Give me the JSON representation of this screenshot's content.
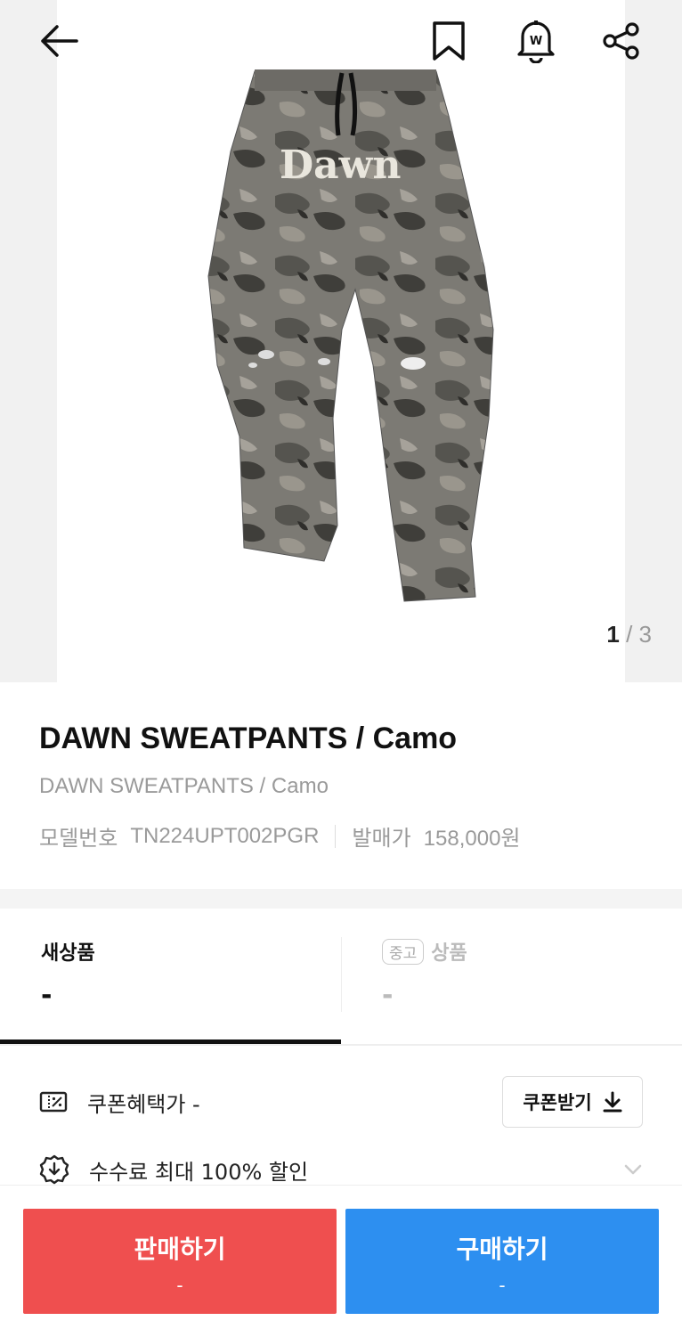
{
  "nav": {
    "back_icon": "arrow-left-icon",
    "bookmark_icon": "bookmark-icon",
    "alarm_icon": "bell-w-icon",
    "share_icon": "share-icon"
  },
  "gallery": {
    "image_text": "Dawn",
    "current": "1",
    "separator": " / ",
    "total": "3"
  },
  "product": {
    "title": "DAWN SWEATPANTS / Camo",
    "subtitle": "DAWN SWEATPANTS / Camo",
    "model_label": "모델번호",
    "model_value": "TN224UPT002PGR",
    "release_label": "발매가",
    "release_value": "158,000원"
  },
  "tabs": {
    "new_label": "새상품",
    "new_price": "-",
    "used_badge": "중고",
    "used_label": "상품",
    "used_price": "-"
  },
  "coupon": {
    "label": "쿠폰혜택가 -",
    "button_label": "쿠폰받기"
  },
  "fee": {
    "label": "수수료 최대 100% 할인"
  },
  "actions": {
    "sell_label": "판매하기",
    "sell_price": "-",
    "buy_label": "구매하기",
    "buy_price": "-"
  },
  "colors": {
    "sell": "#ef4f4f",
    "buy": "#2d8ff0"
  }
}
